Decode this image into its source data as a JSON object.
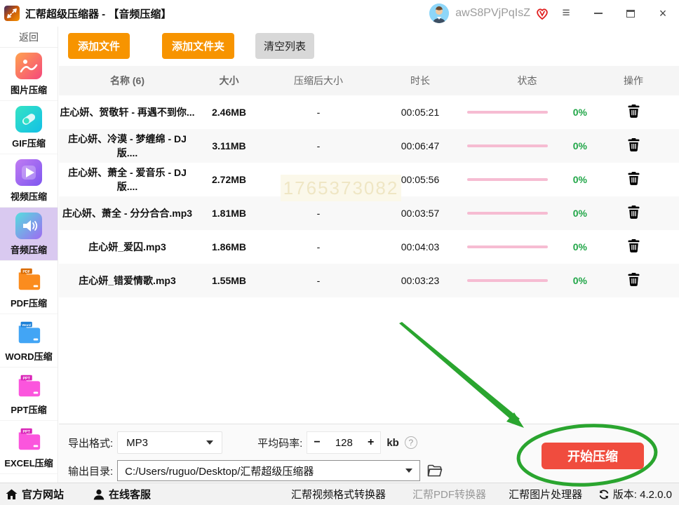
{
  "window": {
    "title": "汇帮超级压缩器 - 【音频压缩】",
    "username": "awS8PVjPqIsZ",
    "controls": {
      "menu_glyph": "≡",
      "close_glyph": "×"
    }
  },
  "sidebar": {
    "back_label": "返回",
    "items": [
      {
        "label": "图片压缩",
        "selected": false
      },
      {
        "label": "GIF压缩",
        "selected": false
      },
      {
        "label": "视频压缩",
        "selected": false
      },
      {
        "label": "音频压缩",
        "selected": true
      },
      {
        "label": "PDF压缩",
        "tag": "PDF",
        "selected": false
      },
      {
        "label": "WORD压缩",
        "tag": "Word",
        "selected": false
      },
      {
        "label": "PPT压缩",
        "tag": "PPT",
        "selected": false
      },
      {
        "label": "EXCEL压缩",
        "tag": "PPT",
        "selected": false
      }
    ]
  },
  "toolbar": {
    "add_file": "添加文件",
    "add_folder": "添加文件夹",
    "clear_list": "清空列表"
  },
  "table": {
    "headers": {
      "name": "名称 (6)",
      "size": "大小",
      "compressed": "压缩后大小",
      "duration": "时长",
      "status": "状态",
      "action": "操作"
    },
    "rows": [
      {
        "name": "庄心妍、贺敬轩 - 再遇不到你...",
        "size": "2.46MB",
        "compressed": "-",
        "duration": "00:05:21",
        "percent": "0%"
      },
      {
        "name": "庄心妍、冷漠 - 梦缠绵 - DJ版....",
        "size": "3.11MB",
        "compressed": "-",
        "duration": "00:06:47",
        "percent": "0%"
      },
      {
        "name": "庄心妍、萧全 - 爱音乐 - DJ版....",
        "size": "2.72MB",
        "compressed": "-",
        "duration": "00:05:56",
        "percent": "0%"
      },
      {
        "name": "庄心妍、萧全 - 分分合合.mp3",
        "size": "1.81MB",
        "compressed": "-",
        "duration": "00:03:57",
        "percent": "0%"
      },
      {
        "name": "庄心妍_爱囚.mp3",
        "size": "1.86MB",
        "compressed": "-",
        "duration": "00:04:03",
        "percent": "0%"
      },
      {
        "name": "庄心妍_错爱情歌.mp3",
        "size": "1.55MB",
        "compressed": "-",
        "duration": "00:03:23",
        "percent": "0%"
      }
    ],
    "watermark": "1765373082"
  },
  "settings": {
    "export_format_label": "导出格式:",
    "export_format_value": "MP3",
    "bitrate_label": "平均码率:",
    "bitrate_minus": "−",
    "bitrate_value": "128",
    "bitrate_plus": "+",
    "bitrate_unit": "kb",
    "help_glyph": "?",
    "output_dir_label": "输出目录:",
    "output_dir_value": "C:/Users/ruguo/Desktop/汇帮超级压缩器",
    "start_button": "开始压缩"
  },
  "footer": {
    "official_site": "官方网站",
    "online_service": "在线客服",
    "video_converter": "汇帮视频格式转换器",
    "pdf_converter": "汇帮PDF转换器",
    "image_processor": "汇帮图片处理器",
    "version": "版本:  4.2.0.0"
  },
  "colors": {
    "accent_orange": "#f79400",
    "start_red": "#f04c3e",
    "progress_pink": "#f6bcd2",
    "percent_green": "#21a648",
    "annotation_green": "#2aa52f",
    "selected_purple": "#d9c9f0"
  }
}
